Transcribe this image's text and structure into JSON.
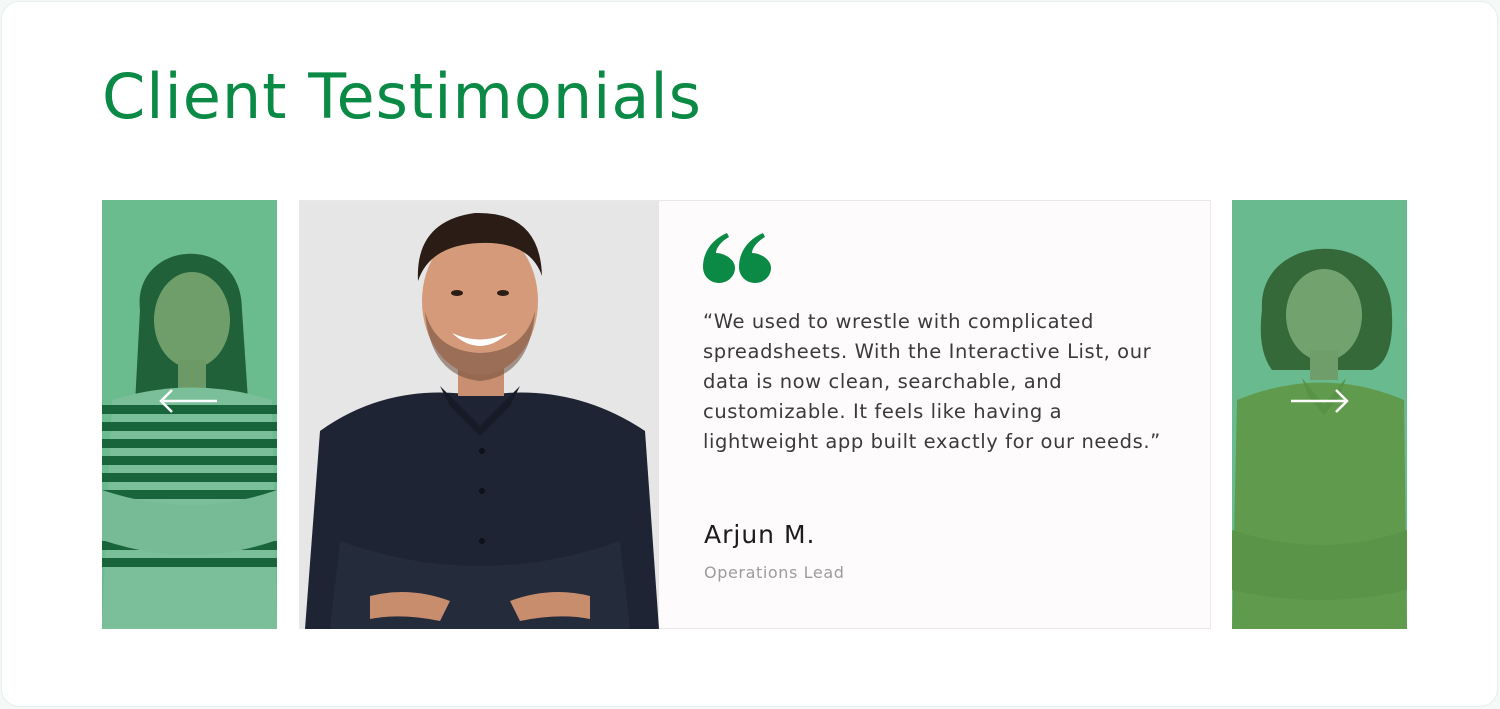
{
  "section": {
    "title": "Client Testimonials"
  },
  "carousel": {
    "prev_icon": "arrow-left-icon",
    "next_icon": "arrow-right-icon",
    "active": {
      "quote_icon": "quote-icon",
      "quote": "“We used to wrestle with complicated spreadsheets. With the Interactive List, our data is now clean, searchable, and customizable. It feels like having a lightweight app built exactly for our needs.”",
      "name": "Arjun M.",
      "role": "Operations Lead"
    }
  },
  "colors": {
    "accent": "#0a8a45",
    "side_overlay": "#2fa067",
    "card_bg": "#fdfbfc",
    "quote_text": "#3a3a3a",
    "role_text": "#9c9c9c"
  }
}
